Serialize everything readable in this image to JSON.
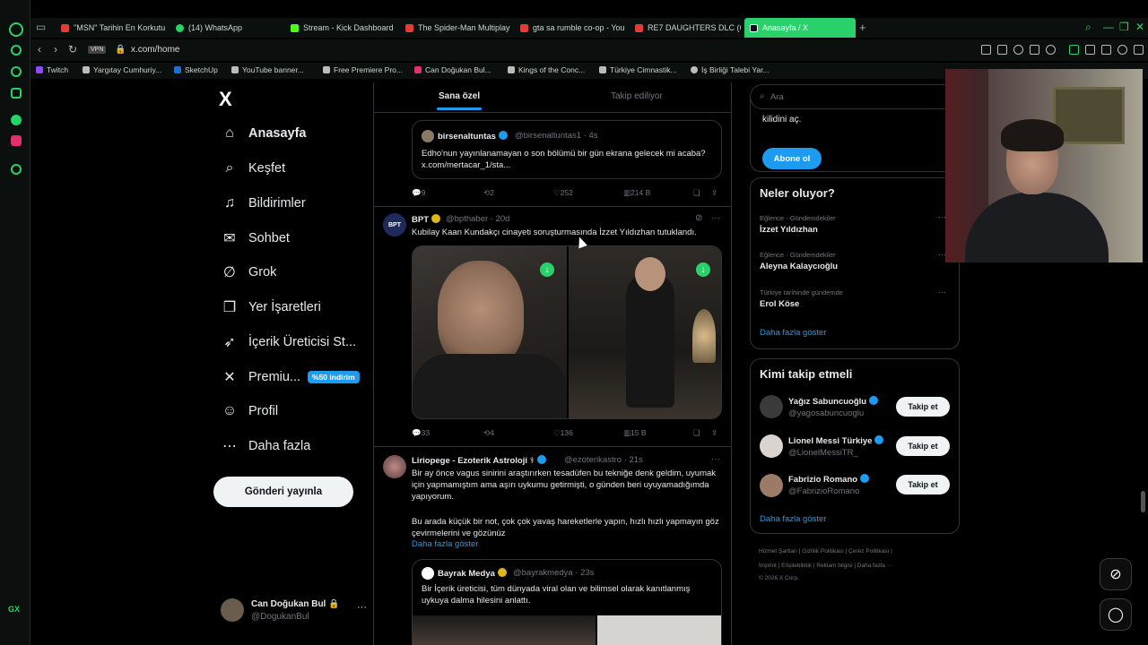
{
  "browser": {
    "tabs": [
      {
        "label": "\"MSN\" Tarihin En Korkutu",
        "color": "#e03b3b"
      },
      {
        "label": "(14) WhatsApp",
        "color": "#25d366"
      },
      {
        "label": "Stream - Kick Dashboard",
        "color": "#53fc18"
      },
      {
        "label": "The Spider-Man Multiplay",
        "color": "#e03b3b"
      },
      {
        "label": "gta sa rumble co-op - You",
        "color": "#e03b3b"
      },
      {
        "label": "RE7 DAUGHTERS DLC (G",
        "color": "#e03b3b"
      },
      {
        "label": "Anasayfa / X",
        "color": "#000000"
      }
    ],
    "new_tab": "+",
    "url": "x.com/home",
    "vpn": "VPN",
    "bookmarks": [
      {
        "label": "Twitch",
        "color": "#9146ff"
      },
      {
        "label": "Yargıtay Cumhuriy...",
        "color": "#bbbbbb"
      },
      {
        "label": "SketchUp",
        "color": "#1d6fd6"
      },
      {
        "label": "YouTube banner...",
        "color": "#bbbbbb"
      },
      {
        "label": "Free Premiere Pro...",
        "color": "#bbbbbb"
      },
      {
        "label": "Can Doğukan Bul...",
        "color": "#e1306c"
      },
      {
        "label": "Kings of the Conc...",
        "color": "#bbbbbb"
      },
      {
        "label": "Türkiye Cimnastik...",
        "color": "#bbbbbb"
      },
      {
        "label": "İş Birliği Talebi Yar...",
        "color": "#bbbbbb"
      }
    ],
    "side_label": "GX"
  },
  "nav": {
    "logo": "X",
    "items": [
      {
        "label": "Anasayfa",
        "icon": "⌂"
      },
      {
        "label": "Keşfet",
        "icon": "⌕"
      },
      {
        "label": "Bildirimler",
        "icon": "♫"
      },
      {
        "label": "Sohbet",
        "icon": "✉"
      },
      {
        "label": "Grok",
        "icon": "∅"
      },
      {
        "label": "Yer İşaretleri",
        "icon": "❒"
      },
      {
        "label": "İçerik Üreticisi St...",
        "icon": "➶"
      },
      {
        "label": "Premiu...",
        "icon": "✕"
      },
      {
        "label": "Profil",
        "icon": "☺"
      },
      {
        "label": "Daha fazla",
        "icon": "⋯"
      }
    ],
    "premium_badge": "%50 indirim",
    "post_button": "Gönderi yayınla",
    "account": {
      "name": "Can Doğukan Bul 🔒",
      "handle": "@DogukanBul",
      "more": "···"
    }
  },
  "feed": {
    "tabs": {
      "for_you": "Sana özel",
      "following": "Takip ediliyor"
    },
    "post1": {
      "quote": {
        "name": "birsenaltuntas",
        "handle": "@birsenaltuntas1 · 4s",
        "text": "Edho'nun yayınlanamayan o son bölümü bir gün ekrana gelecek mi acaba? x.com/mertacar_1/sta..."
      },
      "replies": "9",
      "reposts": "2",
      "likes": "252",
      "views": "214 B"
    },
    "post2": {
      "name": "BPT",
      "handle": "@bpthaber · 20d",
      "text": "Kubilay Kaan Kundakçı cinayeti soruşturmasında İzzet Yıldızhan tutuklandı.",
      "avatar_text": "BPT",
      "replies": "33",
      "reposts": "4",
      "likes": "136",
      "views": "15 B"
    },
    "post3": {
      "name": "Liriopege - Ezoterik Astroloji ⚕",
      "handle": "@ezoterikastro · 21s",
      "text1": "Bir ay önce vagus sinirini araştırırken tesadüfen bu tekniğe denk geldim, uyumak için yapmamıştım ama aşırı uykumu getirmişti, o günden beri uyuyamadığımda yapıyorum.",
      "text2": "Bu arada küçük bir not, çok çok yavaş hareketlerle yapın, hızlı hızlı yapmayın göz çevirmelerini ve gözünüz",
      "show_more": "Daha fazla göster",
      "quote": {
        "name": "Bayrak Medya",
        "handle": "@bayrakmedya · 23s",
        "text": "Bir İçerik üreticisi, tüm dünyada viral olan ve bilimsel olarak kanıtlanmış uykuya dalma hilesini anlattı."
      }
    }
  },
  "right": {
    "search_placeholder": "Ara",
    "premium": {
      "text": "kilidini aç.",
      "button": "Abone ol"
    },
    "trends": {
      "title": "Neler oluyor?",
      "items": [
        {
          "context": "Eğlence · Gündemdekiler",
          "name": "İzzet Yıldızhan"
        },
        {
          "context": "Eğlence · Gündemdekiler",
          "name": "Aleyna Kalaycıoğlu"
        },
        {
          "context": "Türkiye tarihinde gündemde",
          "name": "Erol Köse"
        }
      ],
      "show_more": "Daha fazla göster"
    },
    "who_to_follow": {
      "title": "Kimi takip etmeli",
      "items": [
        {
          "name": "Yağız Sabuncuoğlu",
          "handle": "@yagosabuncuoglu",
          "button": "Takip et",
          "color": "#3a3a3a"
        },
        {
          "name": "Lionel Messi Türkiye",
          "handle": "@LionelMessiTR_",
          "button": "Takip et",
          "color": "#d9d4cf"
        },
        {
          "name": "Fabrizio Romano",
          "handle": "@FabrizioRomano",
          "button": "Takip et",
          "color": "#9b7a66"
        }
      ],
      "show_more": "Daha fazla göster"
    },
    "footer": {
      "line1": "Hizmet Şartları  |  Gizlilik Politikası  |  Çerez Politikası  |",
      "line2": "İmprint  |  Erişilebilirlik  |  Reklam bilgisi  |  Daha fazla ···",
      "line3": "© 2026 X Corp."
    }
  },
  "colors": {
    "accent": "#1d9bf0",
    "opera": "#2ad16a"
  }
}
